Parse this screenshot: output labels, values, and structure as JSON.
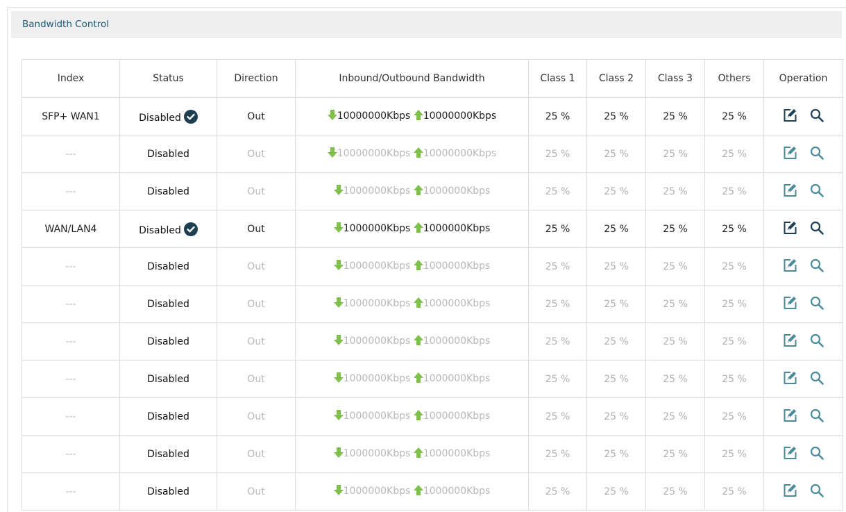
{
  "panel": {
    "title": "Bandwidth Control"
  },
  "colors": {
    "header_text": "#1b5872",
    "arrow": "#7ec04b",
    "icon_active": "#1d3f50",
    "icon_inactive": "#4a8a99"
  },
  "columns": [
    "Index",
    "Status",
    "Direction",
    "Inbound/Outbound Bandwidth",
    "Class 1",
    "Class 2",
    "Class 3",
    "Others",
    "Operation"
  ],
  "rows": [
    {
      "index": "SFP+ WAN1",
      "status": "Disabled",
      "enabled": true,
      "direction": "Out",
      "inbound": "10000000Kbps",
      "outbound": "10000000Kbps",
      "class1": "25 %",
      "class2": "25 %",
      "class3": "25 %",
      "others": "25 %",
      "active": true
    },
    {
      "index": "---",
      "status": "Disabled",
      "enabled": false,
      "direction": "Out",
      "inbound": "10000000Kbps",
      "outbound": "10000000Kbps",
      "class1": "25 %",
      "class2": "25 %",
      "class3": "25 %",
      "others": "25 %",
      "active": false
    },
    {
      "index": "---",
      "status": "Disabled",
      "enabled": false,
      "direction": "Out",
      "inbound": "1000000Kbps",
      "outbound": "1000000Kbps",
      "class1": "25 %",
      "class2": "25 %",
      "class3": "25 %",
      "others": "25 %",
      "active": false
    },
    {
      "index": "WAN/LAN4",
      "status": "Disabled",
      "enabled": true,
      "direction": "Out",
      "inbound": "1000000Kbps",
      "outbound": "1000000Kbps",
      "class1": "25 %",
      "class2": "25 %",
      "class3": "25 %",
      "others": "25 %",
      "active": true
    },
    {
      "index": "---",
      "status": "Disabled",
      "enabled": false,
      "direction": "Out",
      "inbound": "1000000Kbps",
      "outbound": "1000000Kbps",
      "class1": "25 %",
      "class2": "25 %",
      "class3": "25 %",
      "others": "25 %",
      "active": false
    },
    {
      "index": "---",
      "status": "Disabled",
      "enabled": false,
      "direction": "Out",
      "inbound": "1000000Kbps",
      "outbound": "1000000Kbps",
      "class1": "25 %",
      "class2": "25 %",
      "class3": "25 %",
      "others": "25 %",
      "active": false
    },
    {
      "index": "---",
      "status": "Disabled",
      "enabled": false,
      "direction": "Out",
      "inbound": "1000000Kbps",
      "outbound": "1000000Kbps",
      "class1": "25 %",
      "class2": "25 %",
      "class3": "25 %",
      "others": "25 %",
      "active": false
    },
    {
      "index": "---",
      "status": "Disabled",
      "enabled": false,
      "direction": "Out",
      "inbound": "1000000Kbps",
      "outbound": "1000000Kbps",
      "class1": "25 %",
      "class2": "25 %",
      "class3": "25 %",
      "others": "25 %",
      "active": false
    },
    {
      "index": "---",
      "status": "Disabled",
      "enabled": false,
      "direction": "Out",
      "inbound": "1000000Kbps",
      "outbound": "1000000Kbps",
      "class1": "25 %",
      "class2": "25 %",
      "class3": "25 %",
      "others": "25 %",
      "active": false
    },
    {
      "index": "---",
      "status": "Disabled",
      "enabled": false,
      "direction": "Out",
      "inbound": "1000000Kbps",
      "outbound": "1000000Kbps",
      "class1": "25 %",
      "class2": "25 %",
      "class3": "25 %",
      "others": "25 %",
      "active": false
    },
    {
      "index": "---",
      "status": "Disabled",
      "enabled": false,
      "direction": "Out",
      "inbound": "1000000Kbps",
      "outbound": "1000000Kbps",
      "class1": "25 %",
      "class2": "25 %",
      "class3": "25 %",
      "others": "25 %",
      "active": false
    }
  ],
  "icons": {
    "enabled": "check-circle-icon",
    "inbound": "arrow-down-icon",
    "outbound": "arrow-up-icon",
    "edit": "edit-icon",
    "view": "magnifier-icon"
  }
}
